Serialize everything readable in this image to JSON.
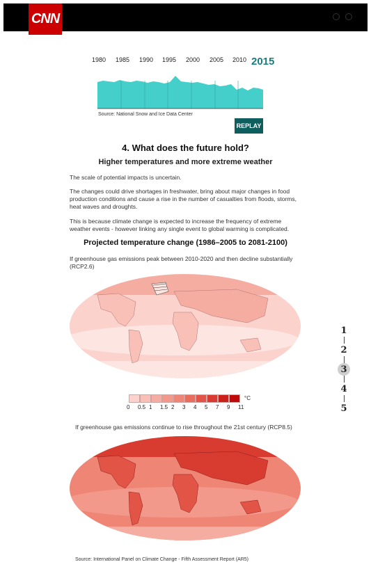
{
  "header": {
    "logo_text": "CNN"
  },
  "ice_chart": {
    "years": [
      "1980",
      "1985",
      "1990",
      "1995",
      "2000",
      "2005",
      "2010"
    ],
    "current_year": "2015",
    "source": "Source: National Snow and Ice Data Center",
    "replay_label": "REPLAY",
    "fill_color": "#44cfcb"
  },
  "article": {
    "section_heading": "4. What does the future hold?",
    "subheading": "Higher temperatures and more extreme weather",
    "paragraph_1": "The scale of potential impacts is uncertain.",
    "paragraph_2": "The changes could drive shortages in freshwater, bring about major changes in food production conditions and cause a rise in the number of casualties from floods, storms, heat waves and droughts.",
    "paragraph_3": "This is because climate change is expected to increase the frequency of extreme weather events - however linking any single event to global warming is complicated."
  },
  "projection": {
    "heading": "Projected temperature change (1986–2005 to 2081-2100)",
    "caption_rcp26": "If greenhouse gas emissions peak between 2010-2020 and then decline substantially (RCP2.6)",
    "caption_rcp85": "If greenhouse gas emissions continue to rise throughout the 21st century (RCP8.5)",
    "legend_values": [
      "0",
      "0.5",
      "1",
      "1.5",
      "2",
      "3",
      "4",
      "5",
      "7",
      "9",
      "11"
    ],
    "legend_unit": "°C",
    "legend_colors": [
      "#fde6e2",
      "#fbd3cc",
      "#f9c0b7",
      "#f6ada1",
      "#f3998b",
      "#ef8575",
      "#e96d5d",
      "#e25446",
      "#d83b30",
      "#cc2119",
      "#bd0a0a"
    ],
    "source": "Source: International Panel on Climate Change - Fifth Assessment Report (AR5)"
  },
  "pager": {
    "items": [
      "1",
      "2",
      "3",
      "4",
      "5"
    ],
    "active": "3"
  }
}
